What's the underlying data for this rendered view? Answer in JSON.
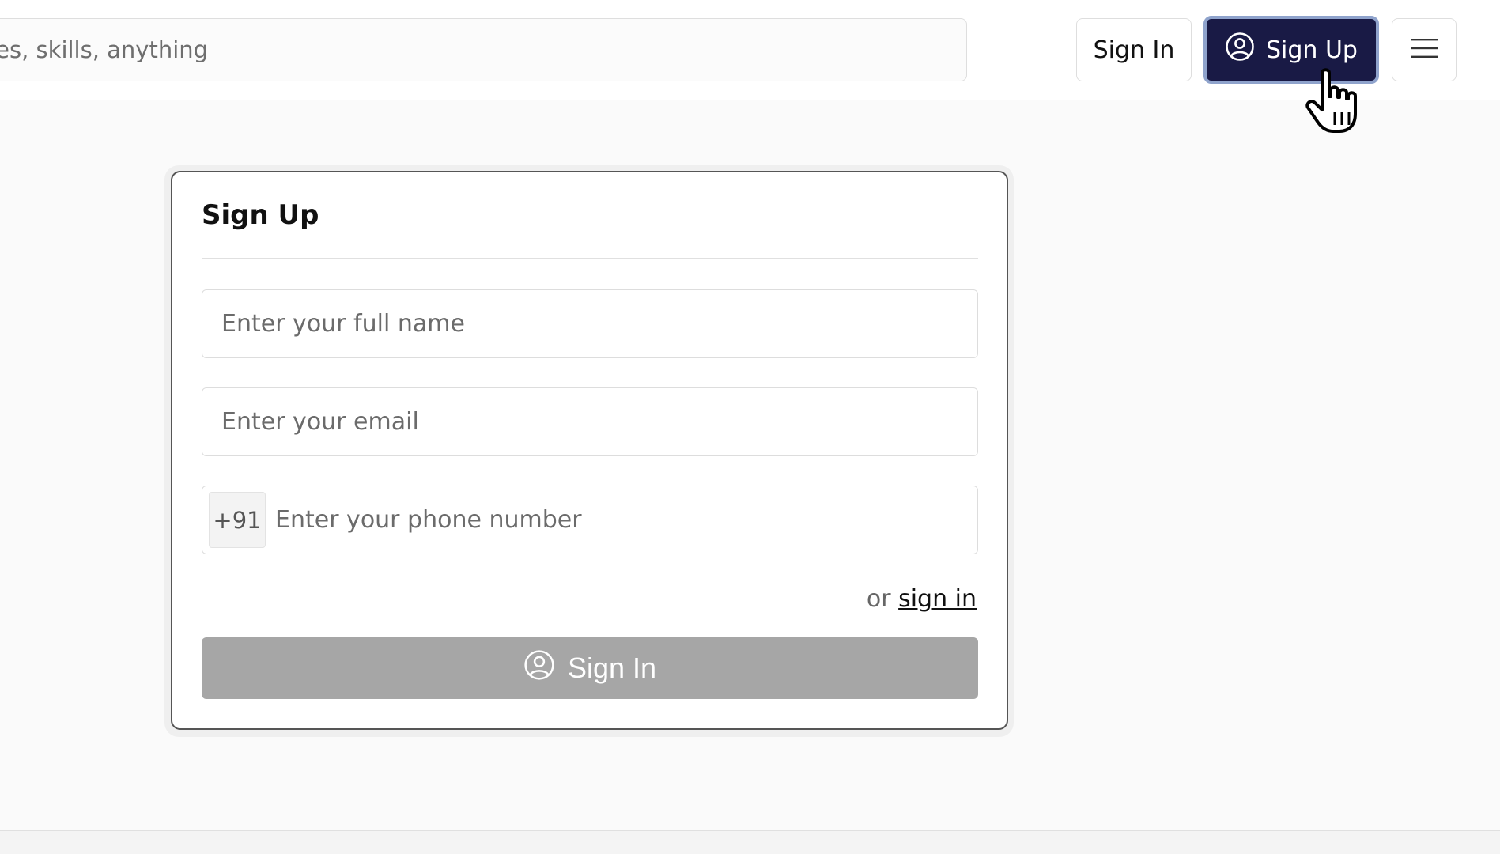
{
  "header": {
    "search_placeholder": "ourses, skills, anything",
    "signin_label": "Sign In",
    "signup_label": "Sign Up",
    "menu_icon": "hamburger-icon",
    "signup_icon": "user-circle-icon"
  },
  "form": {
    "title": "Sign Up",
    "name_placeholder": "Enter your full name",
    "email_placeholder": "Enter your email",
    "phone_prefix": "+91",
    "phone_placeholder": "Enter your phone number",
    "alt_prefix": "or",
    "alt_link": "sign in",
    "submit_label": "Sign In",
    "submit_icon": "user-circle-icon",
    "submit_disabled": true
  },
  "colors": {
    "primary": "#191a45",
    "primary_focus_ring": "#8fa3cc",
    "disabled_button": "#a6a6a6",
    "page_background": "#fafafa"
  }
}
